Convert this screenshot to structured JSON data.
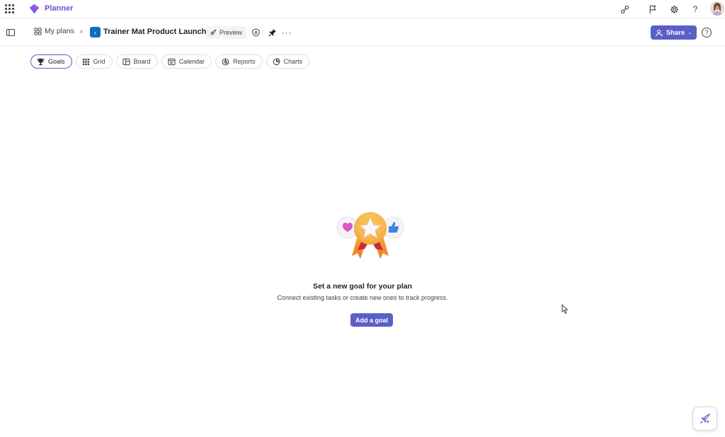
{
  "app": {
    "name": "Planner"
  },
  "breadcrumb": {
    "my_plans": "My plans",
    "plan_title": "Trainer Mat Product Launch"
  },
  "plan_actions": {
    "preview_label": "Preview"
  },
  "share": {
    "label": "Share"
  },
  "tabs": [
    {
      "label": "Goals",
      "icon": "trophy-icon",
      "active": true
    },
    {
      "label": "Grid",
      "icon": "grid-icon",
      "active": false
    },
    {
      "label": "Board",
      "icon": "board-icon",
      "active": false
    },
    {
      "label": "Calendar",
      "icon": "calendar-icon",
      "active": false
    },
    {
      "label": "Reports",
      "icon": "reports-icon",
      "active": false
    },
    {
      "label": "Charts",
      "icon": "charts-icon",
      "active": false
    }
  ],
  "empty_state": {
    "title": "Set a new goal for your plan",
    "subtitle": "Connect existing tasks or create new ones to track progress.",
    "button_label": "Add a goal"
  },
  "colors": {
    "accent": "#5b5fc7",
    "app_brand": "#6b4fd8",
    "plan_icon": "#0f6cbd"
  }
}
